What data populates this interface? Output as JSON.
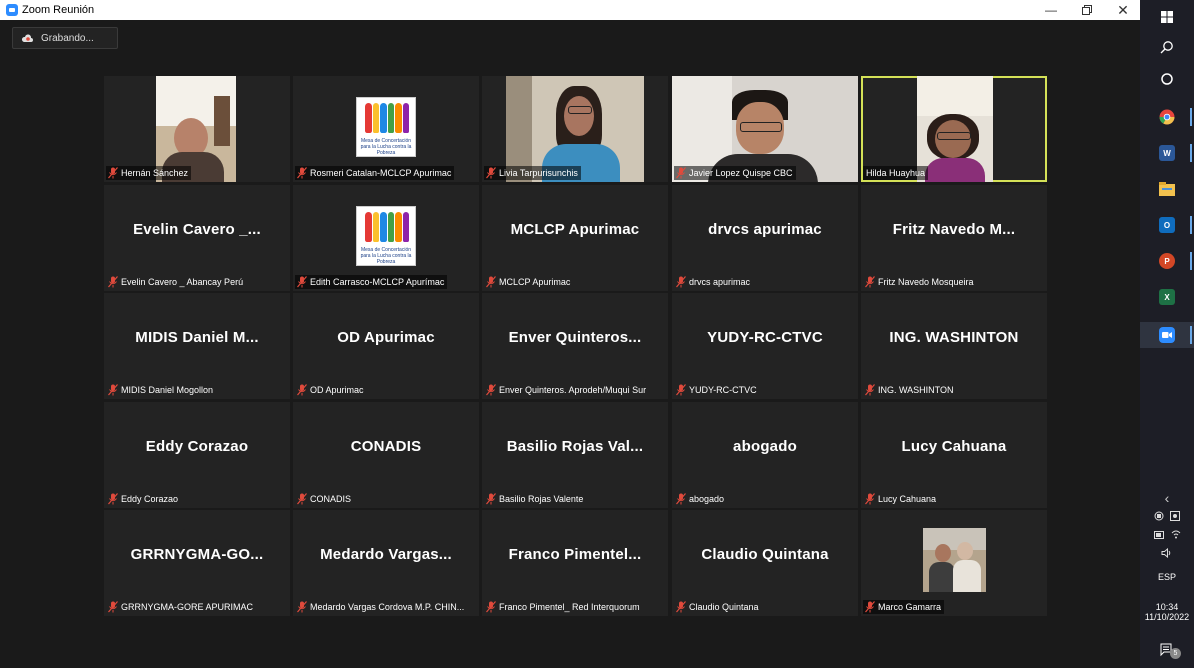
{
  "window": {
    "title": "Zoom Reunión",
    "minimize_icon": "minimize-icon",
    "restore_icon": "restore-icon",
    "close_icon": "close-icon"
  },
  "recording": {
    "label": "Grabando..."
  },
  "tiles": [
    {
      "big": "",
      "name": "Hernán Sánchez",
      "video": "hernan"
    },
    {
      "big": "",
      "name": "Rosmeri Catalan-MCLCP Apurimac",
      "video": "logo"
    },
    {
      "big": "",
      "name": "Livia Tarpurisunchis",
      "video": "livia"
    },
    {
      "big": "",
      "name": "Javier Lopez Quispe CBC",
      "video": "javier"
    },
    {
      "big": "",
      "name": "Hilda Huayhua",
      "video": "hilda",
      "active": true,
      "muted": false
    },
    {
      "big": "Evelin Cavero _...",
      "name": "Evelin Cavero _ Abancay Perú"
    },
    {
      "big": "",
      "name": "Edith Carrasco-MCLCP Apurímac",
      "video": "logo"
    },
    {
      "big": "MCLCP Apurimac",
      "name": "MCLCP Apurimac"
    },
    {
      "big": "drvcs apurimac",
      "name": "drvcs apurimac"
    },
    {
      "big": "Fritz Navedo M...",
      "name": "Fritz Navedo Mosqueira"
    },
    {
      "big": "MIDIS Daniel M...",
      "name": "MIDIS Daniel Mogollon"
    },
    {
      "big": "OD Apurimac",
      "name": "OD Apurimac"
    },
    {
      "big": "Enver Quinteros...",
      "name": "Enver Quinteros. Aprodeh/Muqui Sur"
    },
    {
      "big": "YUDY-RC-CTVC",
      "name": "YUDY-RC-CTVC"
    },
    {
      "big": "ING. WASHINTON",
      "name": "ING. WASHINTON"
    },
    {
      "big": "Eddy Corazao",
      "name": "Eddy Corazao"
    },
    {
      "big": "CONADIS",
      "name": "CONADIS"
    },
    {
      "big": "Basilio Rojas Val...",
      "name": "Basilio Rojas Valente"
    },
    {
      "big": "abogado",
      "name": "abogado"
    },
    {
      "big": "Lucy Cahuana",
      "name": "Lucy Cahuana"
    },
    {
      "big": "GRRNYGMA-GO...",
      "name": "GRRNYGMA-GORE APURIMAC"
    },
    {
      "big": "Medardo Vargas...",
      "name": "Medardo Vargas Cordova M.P. CHIN..."
    },
    {
      "big": "Franco Pimentel...",
      "name": "Franco Pimentel_ Red Interquorum"
    },
    {
      "big": "Claudio Quintana",
      "name": "Claudio Quintana"
    },
    {
      "big": "",
      "name": "Marco Gamarra",
      "video": "marco"
    }
  ],
  "logo": {
    "caption": "Mesa de Concertación para la Lucha contra la Pobreza"
  },
  "taskbar": {
    "apps": [
      {
        "name": "windows-start-icon"
      },
      {
        "name": "search-icon"
      },
      {
        "name": "cortana-icon"
      },
      {
        "name": "chrome-icon",
        "color": "#e8453c"
      },
      {
        "name": "word-icon",
        "color": "#2b5797",
        "glyph": "W"
      },
      {
        "name": "file-explorer-icon",
        "color": "#f2c14e"
      },
      {
        "name": "outlook-icon",
        "color": "#0f6cbd",
        "glyph": "O"
      },
      {
        "name": "powerpoint-icon",
        "color": "#d24726",
        "glyph": "P"
      },
      {
        "name": "excel-icon",
        "color": "#1e7145",
        "glyph": "X"
      },
      {
        "name": "zoom-icon",
        "color": "#2d8cff"
      }
    ],
    "lang": "ESP",
    "time": "10:34",
    "date": "11/10/2022",
    "notifications": "5"
  },
  "colors": {
    "active_speaker": "#d4e157",
    "muted_mic": "#e04a3c",
    "tile_bg": "#232323"
  }
}
